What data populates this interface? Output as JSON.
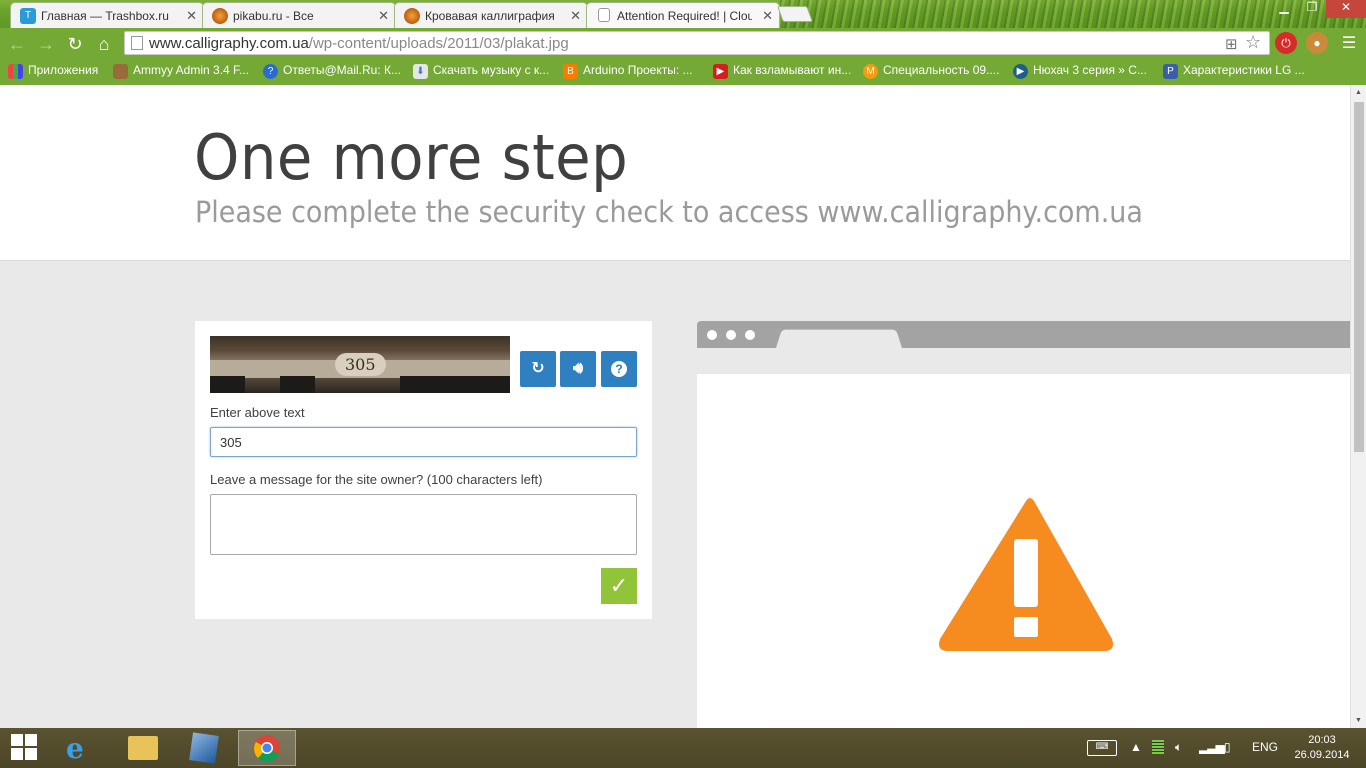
{
  "tabs": [
    {
      "label": "Главная — Trashbox.ru",
      "icon": "trashbox-icon"
    },
    {
      "label": "pikabu.ru - Все",
      "icon": "pikabu-icon"
    },
    {
      "label": "Кровавая каллиграфия",
      "icon": "pikabu-icon"
    },
    {
      "label": "Attention Required! | Clou",
      "icon": "page-icon"
    }
  ],
  "address": {
    "host": "www.calligraphy.com.ua",
    "path": "/wp-content/uploads/2011/03/plakat.jpg"
  },
  "bookmarks": [
    "Приложения",
    "Ammyy Admin 3.4 F...",
    "Ответы@Mail.Ru: К...",
    "Скачать музыку с к...",
    "Arduino Проекты: ...",
    "Как взламывают ин...",
    "Специальность 09....",
    "Нюхач 3 серия » С...",
    "Характеристики LG ..."
  ],
  "page": {
    "title": "One more step",
    "subtitle": "Please complete the security check to access www.calligraphy.com.ua",
    "captcha_text": "305",
    "enter_label": "Enter above text",
    "input_value": "305",
    "message_label": "Leave a message for the site owner? (100 characters left)",
    "submit_glyph": "✓"
  },
  "taskbar": {
    "lang": "ENG",
    "time": "20:03",
    "date": "26.09.2014"
  },
  "colors": {
    "chrome_green": "#74a936",
    "captcha_button_blue": "#2f80c1",
    "submit_green": "#92c43a",
    "warning_orange": "#f68b1f"
  }
}
